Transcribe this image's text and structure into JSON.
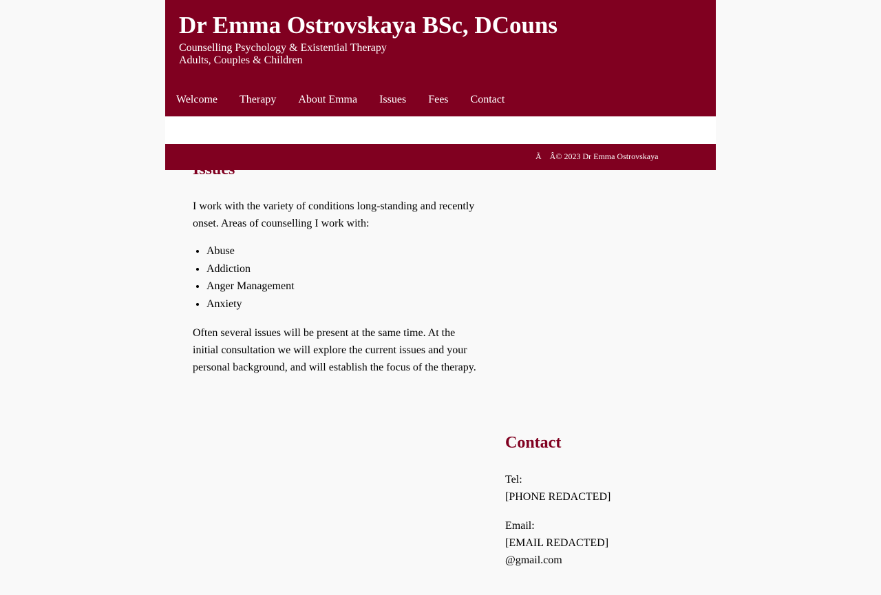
{
  "header": {
    "title": "Dr Emma Ostrovskaya BSc, DCouns",
    "subtitle_line1": "Counselling Psychology & Existential Therapy",
    "subtitle_line2": "Adults, Couples & Children"
  },
  "nav": {
    "items": [
      {
        "label": "Welcome"
      },
      {
        "label": "Therapy"
      },
      {
        "label": "About Emma"
      },
      {
        "label": "Issues"
      },
      {
        "label": "Fees"
      },
      {
        "label": "Contact"
      }
    ]
  },
  "footer": {
    "copyright": "Ã    Â© 2023 Dr Emma Ostrovskaya"
  },
  "issues": {
    "heading": "Issues",
    "intro": "I work with the variety of conditions long-standing and recently onset. Areas of counselling I work with:",
    "list": [
      "Abuse",
      "Addiction",
      "Anger Management",
      "Anxiety"
    ],
    "outro": "Often several issues will be present at the same time. At the initial consultation we will explore the current issues and your personal background, and will establish the focus of the therapy."
  },
  "contact": {
    "heading": "Contact",
    "tel_label": "Tel:",
    "tel_value": "[PHONE REDACTED]",
    "email_label": "Email:",
    "email_value_line1": "[EMAIL REDACTED]",
    "email_value_line2": "@gmail.com"
  },
  "colors": {
    "brand": "#800020",
    "background": "#f9f9f9"
  }
}
